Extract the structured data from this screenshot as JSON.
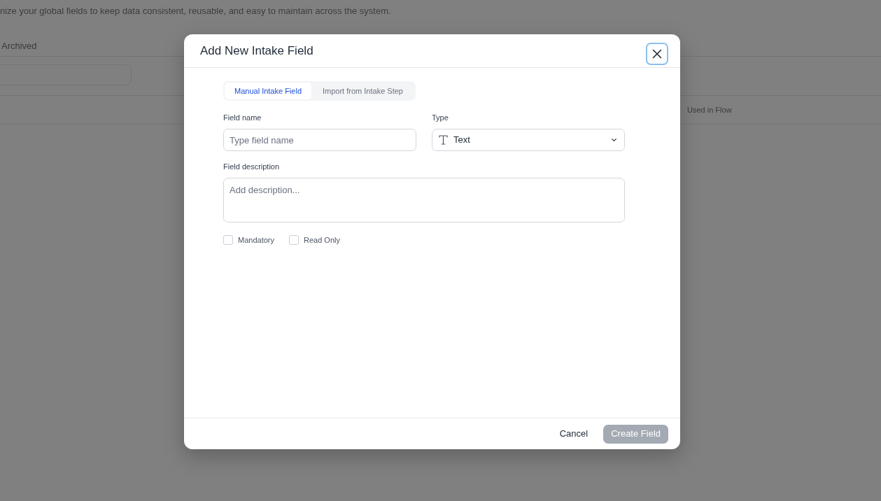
{
  "background_page": {
    "subtitle": "nize your global fields to keep data consistent, reusable, and easy to maintain across the system.",
    "tabs": [
      {
        "label": "Archived",
        "selected": false
      }
    ],
    "table": {
      "columns": [
        "Used in Flow"
      ]
    }
  },
  "dialog": {
    "title": "Add New Intake Field",
    "tabs": [
      {
        "label": "Manual Intake Field",
        "selected": true
      },
      {
        "label": "Import from Intake Step",
        "selected": false
      }
    ],
    "fields": [
      {
        "kind": "text",
        "label": "Field name",
        "placeholder": "Type field name"
      },
      {
        "kind": "select",
        "label": "Type",
        "value": "Text"
      },
      {
        "kind": "textarea",
        "label": "Field description",
        "placeholder": "Add description..."
      }
    ],
    "checkboxes": [
      {
        "label": "Mandatory",
        "checked": false
      },
      {
        "label": "Read Only",
        "checked": false
      }
    ],
    "buttons": [
      {
        "kind": "secondary",
        "label": "Cancel",
        "disabled": false
      },
      {
        "kind": "primary",
        "label": "Create Field",
        "disabled": true
      }
    ]
  }
}
